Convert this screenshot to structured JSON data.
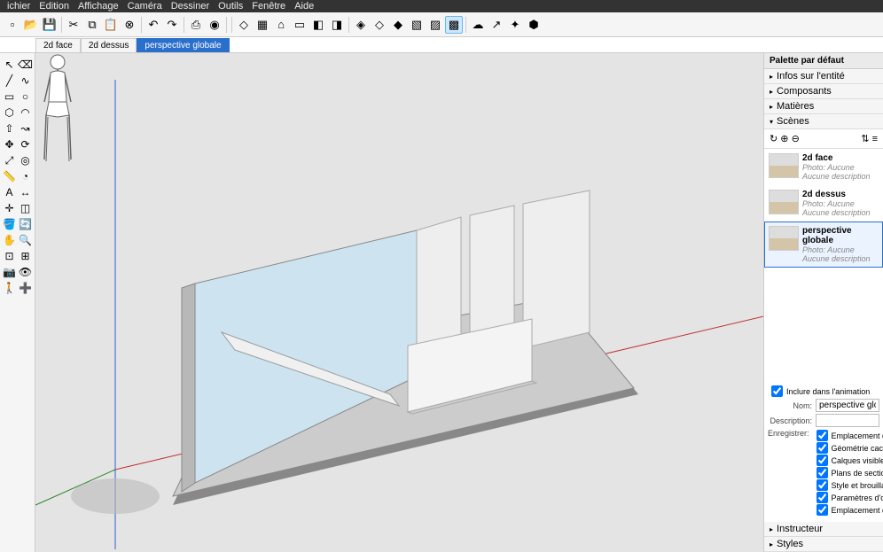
{
  "menubar": [
    "ichier",
    "Edition",
    "Affichage",
    "Caméra",
    "Dessiner",
    "Outils",
    "Fenêtre",
    "Aide"
  ],
  "scene_tabs": [
    {
      "label": "2d face",
      "active": false
    },
    {
      "label": "2d dessus",
      "active": false
    },
    {
      "label": "perspective globale",
      "active": true
    }
  ],
  "right_panel": {
    "title": "Palette par défaut",
    "sections": {
      "entity_info": "Infos sur l'entité",
      "components": "Composants",
      "materials": "Matières",
      "scenes": "Scènes",
      "instructor": "Instructeur",
      "styles": "Styles"
    },
    "scene_list": [
      {
        "name": "2d face",
        "photo": "Photo: Aucune",
        "desc": "Aucune description",
        "selected": false
      },
      {
        "name": "2d dessus",
        "photo": "Photo: Aucune",
        "desc": "Aucune description",
        "selected": false
      },
      {
        "name": "perspective globale",
        "photo": "Photo: Aucune",
        "desc": "Aucune description",
        "selected": true
      }
    ],
    "scene_props": {
      "include_anim_label": "Inclure dans l'animation",
      "include_anim_checked": true,
      "name_label": "Nom:",
      "name_value": "perspective globale",
      "desc_label": "Description:",
      "desc_value": "",
      "save_label": "Enregistrer:",
      "checks": [
        {
          "label": "Emplacement de la caméra",
          "checked": true
        },
        {
          "label": "Géométrie cachée",
          "checked": true
        },
        {
          "label": "Calques visibles",
          "checked": true
        },
        {
          "label": "Plans de section actifs",
          "checked": true
        },
        {
          "label": "Style et brouillard",
          "checked": true
        },
        {
          "label": "Paramètres d'ombre",
          "checked": true
        },
        {
          "label": "Emplacement des axes",
          "checked": true
        }
      ]
    }
  },
  "toolbar_icons": [
    "new-icon",
    "open-icon",
    "save-icon",
    "sep",
    "cut-icon",
    "copy-icon",
    "paste-icon",
    "delete-icon",
    "sep",
    "undo-icon",
    "redo-icon",
    "sep",
    "print-icon",
    "model-icon",
    "sep",
    "sep",
    "iso-icon",
    "top-icon",
    "front-icon",
    "back-icon",
    "left-icon",
    "right-icon",
    "sep",
    "xray-icon",
    "wire-icon",
    "hidden-icon",
    "shaded-icon",
    "shaded-tex-icon",
    "mono-icon",
    "sep",
    "warehouse-icon",
    "share-icon",
    "extension-icon",
    "component-icon"
  ],
  "tool_palette": [
    [
      "select-tool",
      "eraser-tool"
    ],
    [
      "line-tool",
      "freehand-tool"
    ],
    [
      "rectangle-tool",
      "circle-tool"
    ],
    [
      "polygon-tool",
      "arc-tool"
    ],
    [
      "pushpull-tool",
      "followme-tool"
    ],
    [
      "move-tool",
      "rotate-tool"
    ],
    [
      "scale-tool",
      "offset-tool"
    ],
    [
      "tape-tool",
      "protractor-tool"
    ],
    [
      "text-tool",
      "dimension-tool"
    ],
    [
      "axes-tool",
      "section-tool"
    ],
    [
      "paint-tool",
      "orbit-tool"
    ],
    [
      "pan-tool",
      "zoom-tool"
    ],
    [
      "zoomwindow-tool",
      "zoomextents-tool"
    ],
    [
      "position-tool",
      "lookaround-tool"
    ],
    [
      "walk-tool",
      "addscene-tool"
    ]
  ]
}
